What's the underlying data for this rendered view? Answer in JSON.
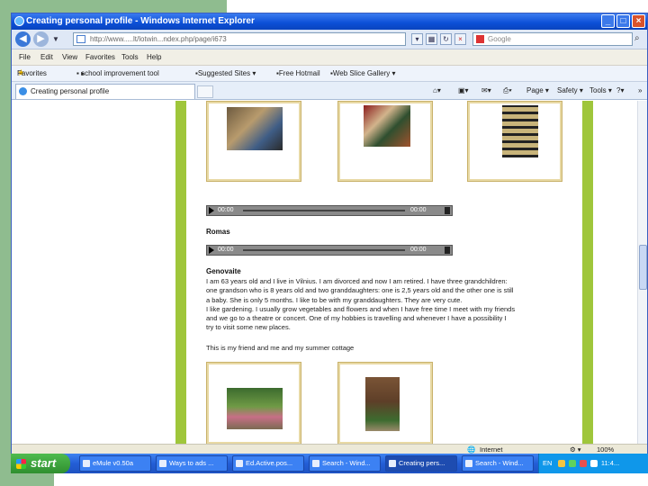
{
  "browser": {
    "title": "Creating personal profile - Windows Internet Explorer",
    "url": "http://www.....lt/lotwin...ndex.php/page/i673",
    "search_placeholder": "Google",
    "menu": [
      "File",
      "Edit",
      "View",
      "Favorites",
      "Tools",
      "Help"
    ],
    "favorites_label": "Favorites",
    "favorites_items": [
      "school improvement tool",
      "Suggested Sites ▾",
      "Free Hotmail",
      "Web Slice Gallery ▾"
    ],
    "tab_label": "Creating personal profile",
    "commands": [
      "Page ▾",
      "Safety ▾",
      "Tools ▾"
    ],
    "status_zone": "Internet",
    "zoom": "100%"
  },
  "page": {
    "audio_start": "00:00",
    "audio_end": "00:00",
    "persons": [
      {
        "name": "Romas"
      },
      {
        "name": "Genovaite"
      }
    ],
    "bio_lines": [
      "I am 63 years old and I live in Vilnius. I am divorced and now I am retired. I have three grandchildren:",
      "one grandson who is 8 years old and two granddaughters: one is 2,5 years old and the other one is still",
      "a baby. She is only 5 months. I like to be with my granddaughters. They are very cute.",
      "I like gardening. I usually grow vegetables and flowers and when I have free time I meet with my friends",
      "and we go to a theatre or concert. One of my hobbies is travelling and whenever I have a possibility I",
      "try to visit some new places."
    ],
    "caption": "This is my friend and me and my summer cottage"
  },
  "taskbar": {
    "start_label": "start",
    "tasks": [
      "eMule v0.50a",
      "Ways to ads ...",
      "Ed.Active.pos...",
      "Search - Wind...",
      "Creating pers...",
      "Search - Wind..."
    ],
    "lang": "EN",
    "clock": "11:4..."
  },
  "colors": {
    "page_border_green": "#9fc63b",
    "slide_green": "#8fbc8f",
    "titlebar_blue": "#0b4fd6",
    "start_green": "#3aa53a"
  }
}
